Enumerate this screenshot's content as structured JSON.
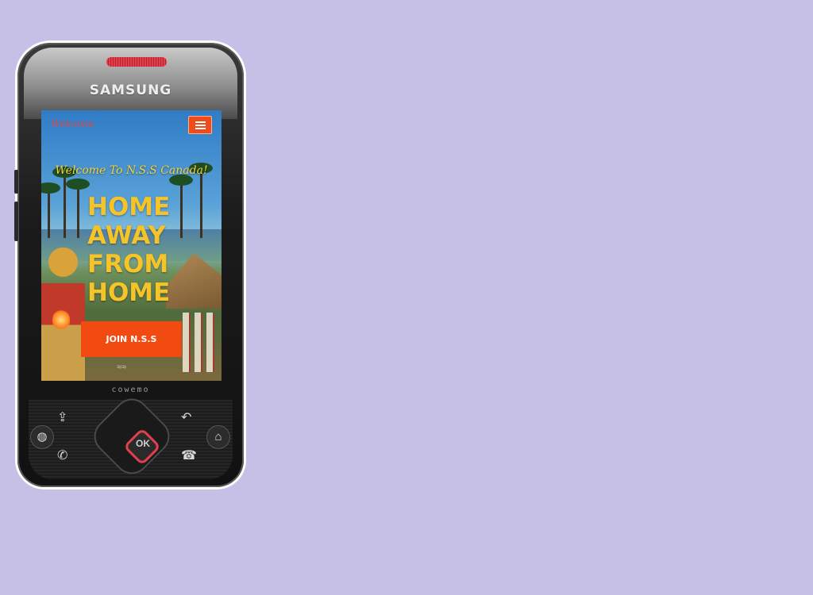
{
  "device": {
    "brand": "SAMSUNG",
    "maker_label": "cowemo"
  },
  "site": {
    "nav_logo": "Welcome",
    "welcome_text": "Welcome To N.S.S Canada!",
    "headline": [
      "HOME",
      "AWAY",
      "FROM",
      "HOME"
    ],
    "cta_label": "JOIN N.S.S",
    "menu_icon": "hamburger-menu-icon"
  },
  "keys": {
    "ok_label": "OK",
    "up_left_icon": "upload-icon",
    "up_right_icon": "back-icon",
    "left_icon": "globe-icon",
    "right_icon": "home-icon",
    "call_icon": "call-icon",
    "end_icon": "end-call-icon"
  },
  "colors": {
    "background": "#c6bfe6",
    "accent": "#f14b12",
    "headline": "#f6c329"
  }
}
